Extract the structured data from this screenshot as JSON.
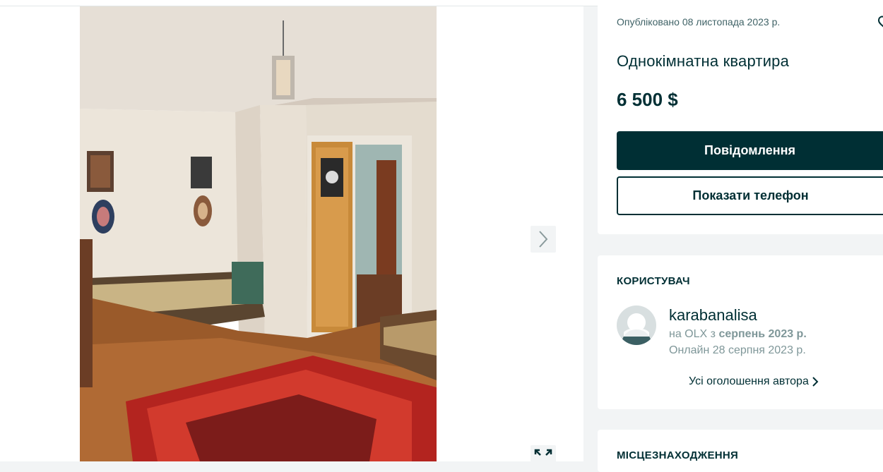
{
  "gallery": {
    "photo_alt": "",
    "next_icon": "chevron-right-icon",
    "fullscreen_icon": "expand-icon"
  },
  "offer": {
    "posted": "Опубліковано 08 листопада 2023 р.",
    "title": "Однокімнатна квартира",
    "price": "6 500 $",
    "message_button": "Повідомлення",
    "phone_button": "Показати телефон",
    "favorite_icon": "heart-icon"
  },
  "user": {
    "heading": "КОРИСТУВАЧ",
    "name": "karabanalisa",
    "since_prefix": "на OLX з",
    "since_value": "серпень 2023 р.",
    "online": "Онлайн 28 серпня 2023 р.",
    "all_ads": "Усі оголошення автора"
  },
  "location": {
    "heading": "МІСЦЕЗНАХОДЖЕННЯ"
  },
  "colors": {
    "primary": "#002f34",
    "muted": "#7f9799",
    "background": "#f2f4f5"
  }
}
